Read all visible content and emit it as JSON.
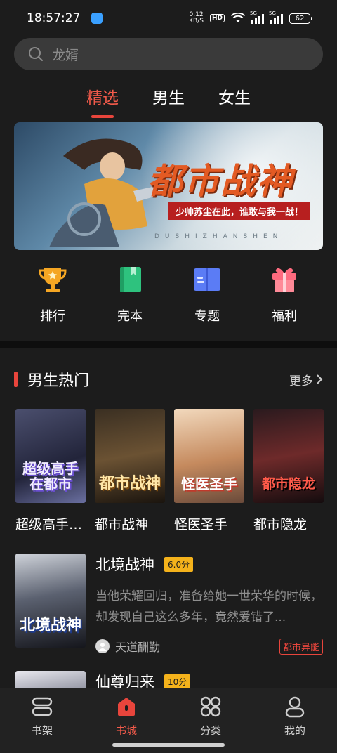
{
  "status_bar": {
    "time": "18:57:27",
    "net_speed": "0.12",
    "net_unit": "KB/S",
    "hd": "HD",
    "sig1": "5G",
    "sig2": "5G",
    "battery": "62"
  },
  "search": {
    "placeholder": "龙婿"
  },
  "tabs": [
    {
      "label": "精选",
      "active": true
    },
    {
      "label": "男生",
      "active": false
    },
    {
      "label": "女生",
      "active": false
    }
  ],
  "banner": {
    "title": "都市战神",
    "slogan": "少帅苏尘在此，谁敢与我一战！",
    "pinyin": "DUSHIZHANSHEN"
  },
  "entries": [
    {
      "label": "排行",
      "icon": "trophy-icon"
    },
    {
      "label": "完本",
      "icon": "book-icon"
    },
    {
      "label": "专题",
      "icon": "open-book-icon"
    },
    {
      "label": "福利",
      "icon": "gift-icon"
    }
  ],
  "section": {
    "title": "男生热门",
    "more": "更多"
  },
  "grid_books": [
    {
      "name": "超级高手在都市",
      "cover_text": "超级高手在都市"
    },
    {
      "name": "都市战神",
      "cover_text": "都市战神"
    },
    {
      "name": "怪医圣手",
      "cover_text": "怪医圣手"
    },
    {
      "name": "都市隐龙",
      "cover_text": "都市隐龙"
    }
  ],
  "list_items": [
    {
      "name": "北境战神",
      "score": "6.0分",
      "desc": "当他荣耀回归，准备给她一世荣华的时候，却发现自己这么多年，竟然爱错了...",
      "author": "天道酬勤",
      "tag": "都市异能",
      "cover_text": "北境战神"
    },
    {
      "name": "仙尊归来",
      "score": "10分"
    }
  ],
  "nav": [
    {
      "label": "书架",
      "icon": "bookshelf-icon",
      "active": false
    },
    {
      "label": "书城",
      "icon": "bookstore-icon",
      "active": true
    },
    {
      "label": "分类",
      "icon": "category-icon",
      "active": false
    },
    {
      "label": "我的",
      "icon": "profile-icon",
      "active": false
    }
  ],
  "colors": {
    "accent": "#e8453c",
    "score": "#f4b21b",
    "background": "#1c1c1c"
  }
}
